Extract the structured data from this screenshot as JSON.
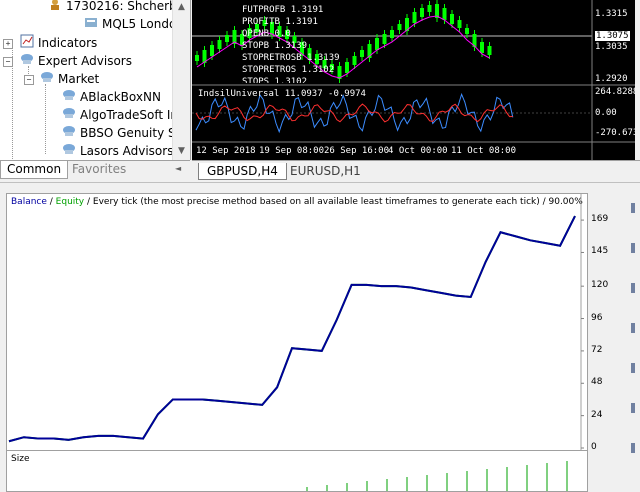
{
  "navigator": {
    "account_label": "1730216: Shcherb",
    "server_label": "MQL5 Londo",
    "indicators_label": "Indicators",
    "experts_label": "Expert Advisors",
    "market_label": "Market",
    "items": [
      "ABlackBoxNN",
      "AlgoTradeSoft In",
      "BBSO Genuity Sc",
      "Lasors Advisors"
    ],
    "tabs": [
      "Common",
      "Favorites"
    ]
  },
  "chart": {
    "overlay_lines": [
      "FUTPROFB  1.3191",
      "PROFITB  1.3191",
      "OPENB  0.0",
      "STOPB  1.3139",
      "STOPRETROSB  1.3139",
      "STOPRETROS  1.3102",
      "STOPS  1.3102"
    ],
    "price_labels": [
      "1.3315",
      "1.3075",
      "1.3035",
      "1.2920"
    ],
    "indicator_label": "IndsilUniversal 11.0937 -0.9974",
    "indicator_scale": [
      "264.8288",
      "0.00",
      "-270.6731"
    ],
    "time_labels": [
      "12 Sep 2018",
      "19 Sep 08:00",
      "26 Sep 16:00",
      "4 Oct 00:00",
      "11 Oct 08:00"
    ],
    "tabs": [
      "GBPUSD,H4",
      "EURUSD,H1"
    ]
  },
  "report": {
    "legend_balance": "Balance",
    "legend_sep1": " / ",
    "legend_equity": "Equity",
    "legend_rest": " / Every tick (the most precise method based on all available least timeframes to generate each tick) / 90.00%",
    "size_label": "Size"
  },
  "chart_data": {
    "type": "line",
    "title": "",
    "xlabel": "",
    "ylabel": "",
    "ylim": [
      0,
      175
    ],
    "yticks": [
      0,
      24,
      48,
      72,
      96,
      120,
      145,
      169
    ],
    "series": [
      {
        "name": "Balance",
        "values": [
          5,
          8,
          7,
          7,
          6,
          8,
          9,
          9,
          8,
          7,
          25,
          36,
          36,
          36,
          35,
          34,
          33,
          32,
          45,
          74,
          73,
          72,
          95,
          121,
          121,
          120,
          120,
          119,
          117,
          115,
          113,
          112,
          138,
          160,
          157,
          154,
          152,
          150,
          172
        ]
      },
      {
        "name": "Equity",
        "values": [
          5,
          8,
          7,
          7,
          6,
          8,
          9,
          9,
          8,
          7,
          25,
          36,
          36,
          36,
          35,
          34,
          33,
          32,
          45,
          74,
          73,
          72,
          95,
          121,
          121,
          120,
          120,
          119,
          117,
          115,
          113,
          112,
          138,
          160,
          157,
          154,
          152,
          150,
          172
        ]
      }
    ],
    "legend": "top-left",
    "grid": false
  },
  "colors": {
    "balance": "#000099",
    "equity": "#00a000",
    "candle_up": "#00ff00",
    "indicator_red": "#ff3030",
    "indicator_blue": "#3c8cff"
  }
}
